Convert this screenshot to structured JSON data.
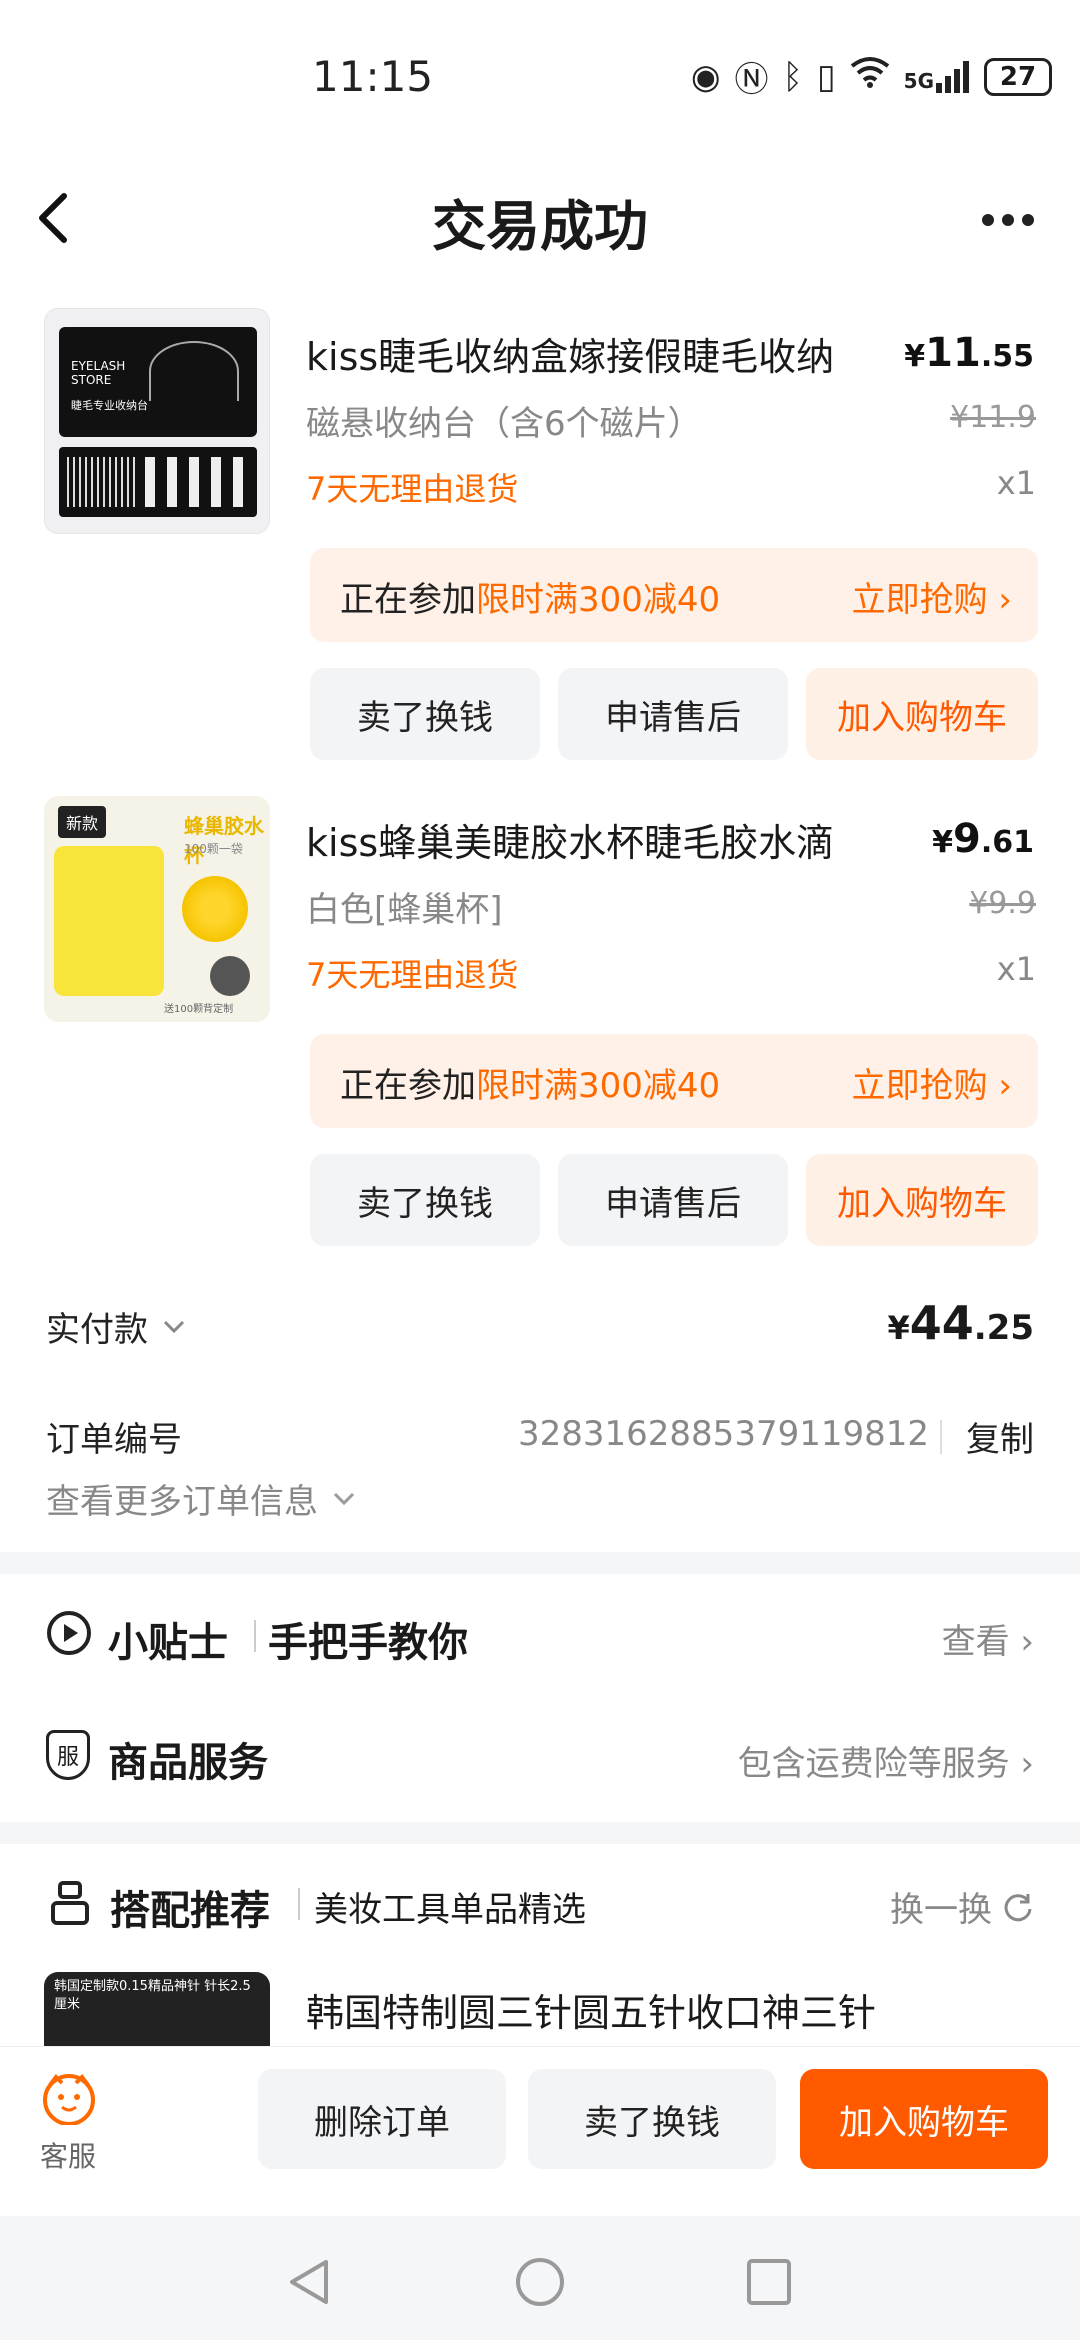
{
  "status_bar": {
    "time": "11:15",
    "network": "5G",
    "battery": "27"
  },
  "header": {
    "title": "交易成功"
  },
  "items": [
    {
      "thumb_text_1": "EYELASH STORE",
      "thumb_text_2": "睫毛专业收纳台",
      "title": "kiss睫毛收纳盒嫁接假睫毛收纳",
      "spec": "磁悬收纳台（含6个磁片）",
      "return_policy": "7天无理由退货",
      "currency": "¥",
      "price_int": "11",
      "price_dec": ".55",
      "orig_price": "¥11.9",
      "qty": "x1",
      "promo_prefix": "正在参加",
      "promo_activity": "限时满300减40",
      "promo_cta": "立即抢购 ›",
      "btn_sell": "卖了换钱",
      "btn_after_sale": "申请售后",
      "btn_cart": "加入购物车"
    },
    {
      "thumb_badge": "新款",
      "thumb_text_1": "蜂巢胶水杯",
      "thumb_text_2": "100颗一袋",
      "thumb_text_3": "送100颗背定制",
      "title": "kiss蜂巢美睫胶水杯睫毛胶水滴",
      "spec": "白色[蜂巢杯]",
      "return_policy": "7天无理由退货",
      "currency": "¥",
      "price_int": "9",
      "price_dec": ".61",
      "orig_price": "¥9.9",
      "qty": "x1",
      "promo_prefix": "正在参加",
      "promo_activity": "限时满300减40",
      "promo_cta": "立即抢购 ›",
      "btn_sell": "卖了换钱",
      "btn_after_sale": "申请售后",
      "btn_cart": "加入购物车"
    }
  ],
  "payment": {
    "label": "实付款",
    "currency": "¥",
    "amount_int": "44",
    "amount_dec": ".25"
  },
  "order": {
    "label": "订单编号",
    "number": "3283162885379119812",
    "copy": "复制",
    "more_info": "查看更多订单信息"
  },
  "tips": {
    "title": "小贴士",
    "subtitle": "手把手教你",
    "action": "查看 ›"
  },
  "service": {
    "icon_text": "服",
    "title": "商品服务",
    "desc": "包含运费险等服务 ›"
  },
  "recommend": {
    "title": "搭配推荐",
    "subtitle": "美妆工具单品精选",
    "refresh": "换一换",
    "item_thumb_text": "韩国定制款0.15精品神针 针长2.5厘米",
    "item_title": "韩国特制圆三针圆五针收口神三针"
  },
  "bottom_bar": {
    "service_label": "客服",
    "btn_delete": "删除订单",
    "btn_sell": "卖了换钱",
    "btn_cart": "加入购物车"
  },
  "colors": {
    "accent": "#ff5a00",
    "promo_bg": "#fff1e8",
    "button_bg": "#f3f4f6",
    "section_gap": "#f4f5f7"
  }
}
